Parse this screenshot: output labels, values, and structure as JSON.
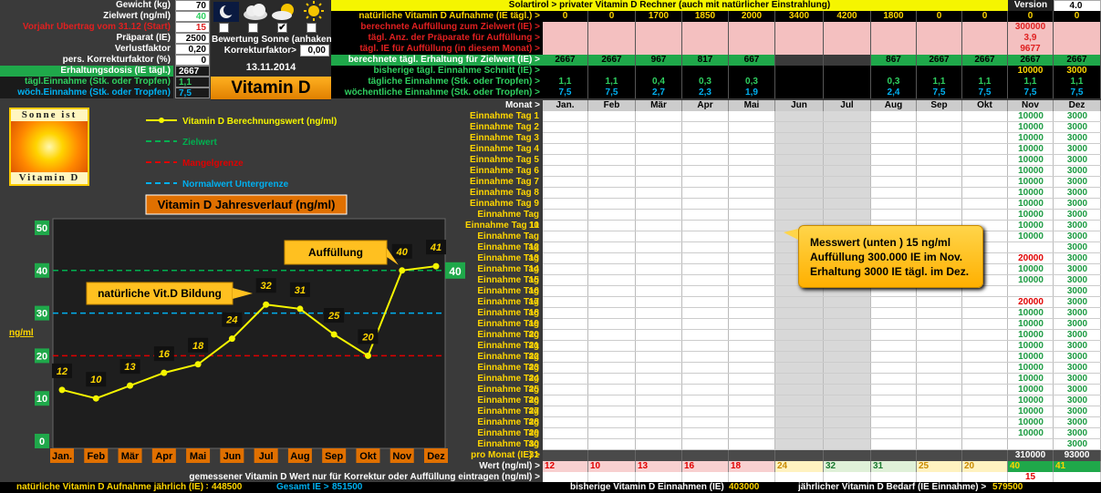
{
  "left_panel": {
    "gewicht_label": "Gewicht (kg)",
    "gewicht": "70",
    "zielwert_label": "Zielwert (ng/ml)",
    "zielwert": "40",
    "vorjahr_label": "Vorjahr Übertrag vom 31.12 (Start)",
    "vorjahr": "15",
    "praeparat_label": "Präparat (IE)",
    "praeparat": "2500",
    "verlust_label": "Verlustfaktor",
    "verlust": "0,20",
    "korrektur_label": "pers. Korrekturfaktor (%)",
    "korrektur": "0",
    "erhaltung_label": "Erhaltungsdosis (IE tägl.)",
    "erhaltung": "2667",
    "taegl_label": "tägl.Einnahme (Stk. oder Tropfen)",
    "taegl": "1,1",
    "woech_label": "wöch.Einnahme (Stk. oder Tropfen)",
    "woech": "7,5"
  },
  "weather": {
    "bewertung_label": "Bewertung Sonne (anhaken)",
    "korrektur_label": "Korrekturfaktor>",
    "korrektur_value": "0,00",
    "date": "13.11.2014",
    "title": "Vitamin D",
    "checks": [
      false,
      false,
      true,
      false
    ]
  },
  "logo": {
    "top": "Sonne ist",
    "bottom": "Vitamin D"
  },
  "header": {
    "title": "Solartirol > privater Vitamin D Rechner (auch mit natürlicher Einstrahlung)",
    "version_label": "Version",
    "version": "4.0"
  },
  "rows": {
    "nat_label": "natürliche Vitamin D Aufnahme (IE tägl.) >",
    "nat": [
      "0",
      "0",
      "1700",
      "1850",
      "2000",
      "3400",
      "4200",
      "1800",
      "0",
      "0",
      "0",
      "0"
    ],
    "auff_label": "berechnete Auffüllung zum Zielwert (IE) >",
    "auff": [
      "",
      "",
      "",
      "",
      "",
      "",
      "",
      "",
      "",
      "",
      "300000",
      ""
    ],
    "anz_label": "tägl. Anz. der Präparate für Auffüllung >",
    "anz": [
      "",
      "",
      "",
      "",
      "",
      "",
      "",
      "",
      "",
      "",
      "3,9",
      ""
    ],
    "ie_label": "tägl. IE für Auffüllung (in diesem Monat) >",
    "ie": [
      "",
      "",
      "",
      "",
      "",
      "",
      "",
      "",
      "",
      "",
      "9677",
      ""
    ],
    "erh_label": "berechnete tägl. Erhaltung für Zielwert (IE) >",
    "erh": [
      "2667",
      "2667",
      "967",
      "817",
      "667",
      "",
      "",
      "867",
      "2667",
      "2667",
      "2667",
      "2667"
    ],
    "bish_label": "bisherige tägl. Einnahme Schnitt (IE) >",
    "bish": [
      "",
      "",
      "",
      "",
      "",
      "",
      "",
      "",
      "",
      "",
      "10000",
      "3000"
    ],
    "taegl_label": "tägliche Einnahme (Stk. oder Tropfen) >",
    "taegl": [
      "1,1",
      "1,1",
      "0,4",
      "0,3",
      "0,3",
      "",
      "",
      "0,3",
      "1,1",
      "1,1",
      "1,1",
      "1,1"
    ],
    "woech_label": "wöchentliche Einnahme (Stk. oder Tropfen) >",
    "woech": [
      "7,5",
      "7,5",
      "2,7",
      "2,3",
      "1,9",
      "",
      "",
      "2,4",
      "7,5",
      "7,5",
      "7,5",
      "7,5"
    ]
  },
  "months_label": "Monat >",
  "months": [
    "Jan.",
    "Feb",
    "Mär",
    "Apr",
    "Mai",
    "Jun",
    "Jul",
    "Aug",
    "Sep",
    "Okt",
    "Nov",
    "Dez"
  ],
  "day_label_prefix": "Einnahme Tag",
  "day_entries": {
    "nov": [
      "10000",
      "10000",
      "10000",
      "10000",
      "10000",
      "10000",
      "10000",
      "10000",
      "10000",
      "10000",
      "10000",
      "10000",
      "",
      "20000",
      "10000",
      "10000",
      "",
      "20000",
      "10000",
      "10000",
      "10000",
      "10000",
      "10000",
      "10000",
      "10000",
      "10000",
      "10000",
      "10000",
      "10000",
      "10000",
      ""
    ],
    "dez": [
      "3000",
      "3000",
      "3000",
      "3000",
      "3000",
      "3000",
      "3000",
      "3000",
      "3000",
      "3000",
      "3000",
      "3000",
      "3000",
      "3000",
      "3000",
      "3000",
      "3000",
      "3000",
      "3000",
      "3000",
      "3000",
      "3000",
      "3000",
      "3000",
      "3000",
      "3000",
      "3000",
      "3000",
      "3000",
      "3000",
      "3000"
    ]
  },
  "pro_monat_label": "pro Monat (IE) >",
  "pro_monat": [
    "",
    "",
    "",
    "",
    "",
    "",
    "",
    "",
    "",
    "",
    "310000",
    "93000"
  ],
  "wert_label": "Wert (ng/ml) >",
  "wert": [
    "12",
    "10",
    "13",
    "16",
    "18",
    "24",
    "32",
    "31",
    "25",
    "20",
    "40",
    "41"
  ],
  "gemessen_label": "gemessener Vitamin D Wert nur für Korrektur oder Auffüllung eintragen (ng/ml) >",
  "gemessen": [
    "",
    "",
    "",
    "",
    "",
    "",
    "",
    "",
    "",
    "",
    "15",
    ""
  ],
  "footer": {
    "nat_label": "natürliche Vitamin D Aufnahme jährlich (IE) >",
    "nat": "448500",
    "gesamt_label": "Gesamt IE >",
    "gesamt": "851500",
    "bish_label": "bisherige Vitamin D Einnahmen (IE) >",
    "bish": "403000",
    "bedarf_label": "jährlicher Vitamin D Bedarf (IE Einnahme) >",
    "bedarf": "579500"
  },
  "callout": {
    "line1": "Messwert (unten ) 15 ng/ml",
    "line2": "Auffüllung  300.000 IE im Nov.",
    "line3": "Erhaltung 3000 IE tägl. im Dez."
  },
  "chart_data": {
    "type": "line",
    "title": "Vitamin D Jahresverlauf (ng/ml)",
    "ylabel": "ng/ml",
    "categories": [
      "Jan.",
      "Feb",
      "Mär",
      "Apr",
      "Mai",
      "Jun",
      "Jul",
      "Aug",
      "Sep",
      "Okt",
      "Nov",
      "Dez"
    ],
    "ylim": [
      0,
      50
    ],
    "yticks": [
      "0",
      "10",
      "20",
      "30",
      "40",
      "50"
    ],
    "series": [
      {
        "name": "Vitamin D Berechnungswert (ng/ml)",
        "values": [
          12,
          10,
          13,
          16,
          18,
          24,
          32,
          31,
          25,
          20,
          40,
          41
        ],
        "color": "#f5f500"
      }
    ],
    "reference_lines": [
      {
        "name": "Zielwert",
        "value": 40,
        "color": "#00b050"
      },
      {
        "name": "Mangelgrenze",
        "value": 20,
        "color": "#e00000"
      },
      {
        "name": "Normalwert Untergrenze",
        "value": 30,
        "color": "#00b0f0"
      }
    ],
    "target_label": "40",
    "annotations": [
      "Auffüllung",
      "natürliche Vit.D Bildung"
    ]
  }
}
